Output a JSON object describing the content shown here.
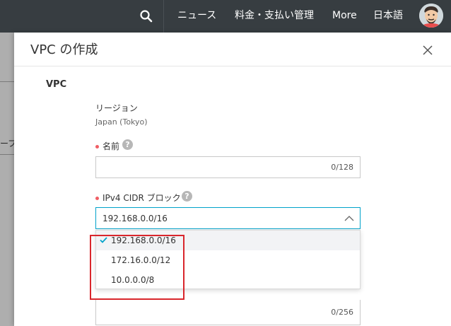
{
  "topbar": {
    "nav": [
      "ニュース",
      "料金・支払い管理",
      "More",
      "日本語"
    ]
  },
  "background": {
    "fragment": "ープ"
  },
  "panel": {
    "title": "VPC の作成",
    "section_title": "VPC",
    "region": {
      "label": "リージョン",
      "value": "Japan (Tokyo)"
    },
    "name_field": {
      "label": "名前",
      "help": "?",
      "counter": "0/128",
      "value": ""
    },
    "cidr_field": {
      "label": "IPv4 CIDR ブロック",
      "help": "?",
      "selected": "192.168.0.0/16",
      "options": [
        "192.168.0.0/16",
        "172.16.0.0/12",
        "10.0.0.0/8"
      ]
    },
    "description_field": {
      "counter": "0/256"
    }
  },
  "colors": {
    "topbar_bg": "#373d41",
    "accent": "#00a2ca",
    "required_dot": "#f05e64",
    "highlight_box": "#d9262c"
  }
}
